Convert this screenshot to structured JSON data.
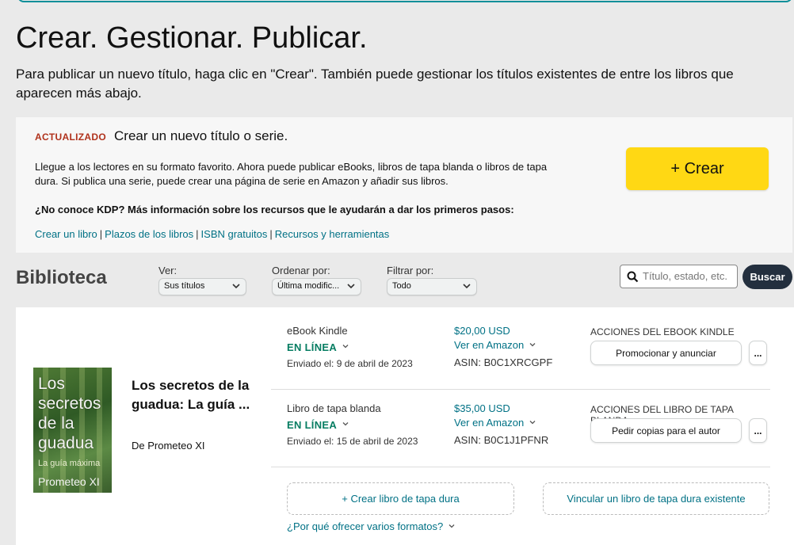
{
  "header": {
    "title": "Crear. Gestionar. Publicar.",
    "intro": "Para publicar un nuevo título, haga clic en \"Crear\". También puede gestionar los títulos existentes de entre los libros que aparecen más abajo."
  },
  "create_panel": {
    "badge": "ACTUALIZADO",
    "title": "Crear un nuevo título o serie.",
    "description": "Llegue a los lectores en su formato favorito. Ahora puede publicar eBooks, libros de tapa blanda o libros de tapa dura. Si publica una serie, puede crear una página de serie en Amazon y añadir sus libros.",
    "question": "¿No conoce KDP? Más información sobre los recursos que le ayudarán a dar los primeros pasos:",
    "links": [
      "Crear un libro",
      "Plazos de los libros",
      "ISBN gratuitos",
      "Recursos y herramientas"
    ],
    "separator": "|",
    "create_button": "+ Crear",
    "button_color": "#ffd814"
  },
  "library": {
    "title": "Biblioteca",
    "filters": {
      "ver": {
        "label": "Ver:",
        "value": "Sus títulos"
      },
      "ordenar": {
        "label": "Ordenar por:",
        "value": "Última modific..."
      },
      "filtrar": {
        "label": "Filtrar por:",
        "value": "Todo"
      }
    },
    "search": {
      "placeholder": "Título, estado, etc.",
      "button": "Buscar"
    }
  },
  "book": {
    "cover": {
      "title": "Los secretos de la guadua",
      "subtitle": "La guía máxima",
      "author": "Prometeo XI"
    },
    "title": "Los secretos de la guadua: La guía ...",
    "author": "De Prometeo XI",
    "formats": [
      {
        "name": "eBook Kindle",
        "status": "EN LÍNEA",
        "sent": "Enviado el: 9 de abril de 2023",
        "price": "$20,00 USD",
        "view": "Ver en Amazon",
        "asin": "ASIN: B0C1XRCGPF",
        "actions_label": "ACCIONES DEL EBOOK KINDLE",
        "action_button": "Promocionar y anunciar",
        "more": "..."
      },
      {
        "name": "Libro de tapa blanda",
        "status": "EN LÍNEA",
        "sent": "Enviado el: 15 de abril de 2023",
        "price": "$35,00 USD",
        "view": "Ver en Amazon",
        "asin": "ASIN: B0C1J1PFNR",
        "actions_label": "ACCIONES DEL LIBRO DE TAPA BLANDA",
        "action_button": "Pedir copias para el autor",
        "more": "..."
      }
    ],
    "create_hardcover": "+ Crear libro de tapa dura",
    "link_hardcover": "Vincular un libro de tapa dura existente",
    "why_formats": "¿Por qué ofrecer varios formatos?"
  },
  "colors": {
    "link": "#007185",
    "status_green": "#067d62",
    "badge_red": "#b0321c",
    "dark_button": "#232f3e"
  }
}
